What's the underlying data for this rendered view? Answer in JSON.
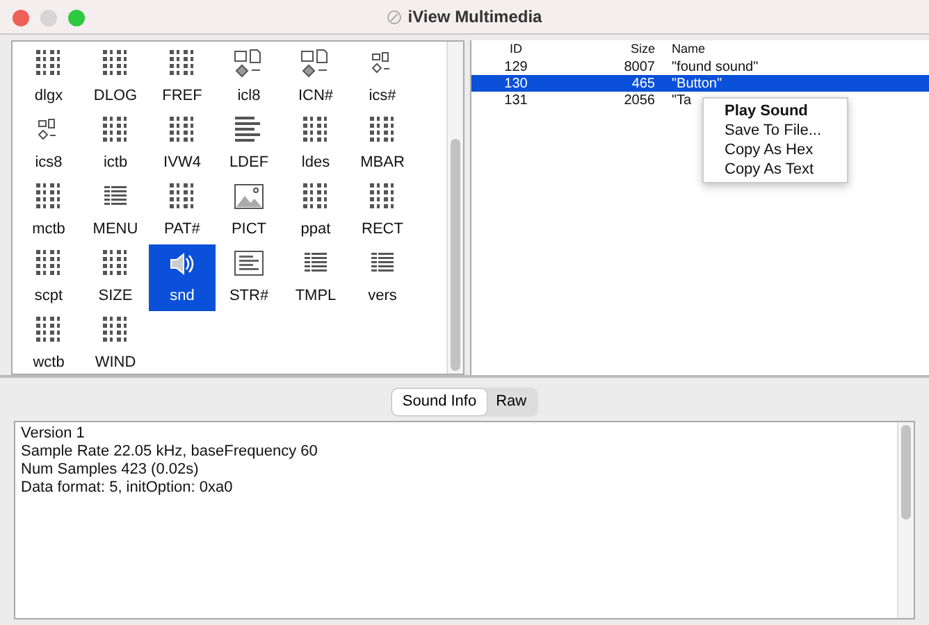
{
  "window": {
    "title": "iView Multimedia"
  },
  "resource_types": [
    {
      "label": "dlgx",
      "kind": "binary",
      "selected": false
    },
    {
      "label": "DLOG",
      "kind": "binary",
      "selected": false
    },
    {
      "label": "FREF",
      "kind": "binary",
      "selected": false
    },
    {
      "label": "icl8",
      "kind": "icon-large",
      "selected": false
    },
    {
      "label": "ICN#",
      "kind": "icon-large",
      "selected": false
    },
    {
      "label": "ics#",
      "kind": "icon-small",
      "selected": false
    },
    {
      "label": "ics8",
      "kind": "icon-small",
      "selected": false
    },
    {
      "label": "ictb",
      "kind": "binary",
      "selected": false
    },
    {
      "label": "IVW4",
      "kind": "binary",
      "selected": false
    },
    {
      "label": "LDEF",
      "kind": "code",
      "selected": false
    },
    {
      "label": "ldes",
      "kind": "binary",
      "selected": false
    },
    {
      "label": "MBAR",
      "kind": "binary",
      "selected": false
    },
    {
      "label": "mctb",
      "kind": "binary",
      "selected": false
    },
    {
      "label": "MENU",
      "kind": "list",
      "selected": false
    },
    {
      "label": "PAT#",
      "kind": "binary",
      "selected": false
    },
    {
      "label": "PICT",
      "kind": "picture",
      "selected": false
    },
    {
      "label": "ppat",
      "kind": "binary",
      "selected": false
    },
    {
      "label": "RECT",
      "kind": "binary",
      "selected": false
    },
    {
      "label": "scpt",
      "kind": "binary",
      "selected": false
    },
    {
      "label": "SIZE",
      "kind": "binary",
      "selected": false
    },
    {
      "label": "snd",
      "kind": "sound",
      "selected": true
    },
    {
      "label": "STR#",
      "kind": "strings",
      "selected": false
    },
    {
      "label": "TMPL",
      "kind": "list",
      "selected": false
    },
    {
      "label": "vers",
      "kind": "list",
      "selected": false
    },
    {
      "label": "wctb",
      "kind": "binary",
      "selected": false
    },
    {
      "label": "WIND",
      "kind": "binary",
      "selected": false
    }
  ],
  "table": {
    "columns": [
      "ID",
      "Size",
      "Name"
    ],
    "rows": [
      {
        "id": "129",
        "size": "8007",
        "name": "\"found sound\"",
        "selected": false
      },
      {
        "id": "130",
        "size": "465",
        "name": "\"Button\"",
        "selected": true
      },
      {
        "id": "131",
        "size": "2056",
        "name": "\"Ta",
        "selected": false
      }
    ]
  },
  "context_menu": [
    {
      "label": "Play Sound",
      "default": true
    },
    {
      "label": "Save To File...",
      "default": false
    },
    {
      "label": "Copy As Hex",
      "default": false
    },
    {
      "label": "Copy As Text",
      "default": false
    }
  ],
  "tabs": [
    {
      "label": "Sound Info",
      "selected": true
    },
    {
      "label": "Raw",
      "selected": false
    }
  ],
  "info_lines": [
    "Version 1",
    "Sample Rate 22.05 kHz, baseFrequency 60",
    "Num Samples 423 (0.02s)",
    "Data format: 5, initOption: 0xa0"
  ]
}
